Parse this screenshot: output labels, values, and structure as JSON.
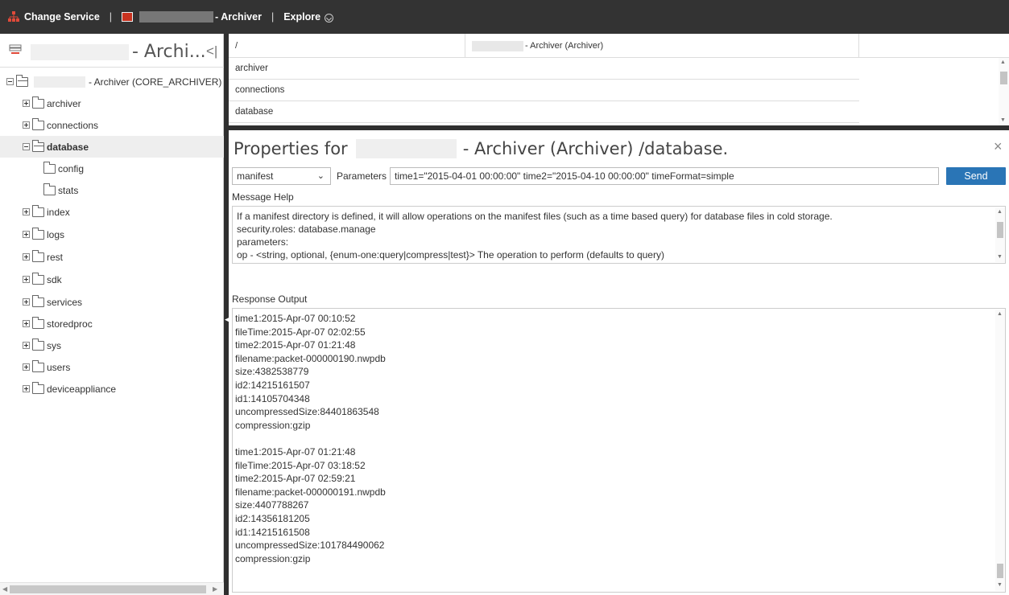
{
  "topbar": {
    "change_service": "Change Service",
    "service_name_suffix": "- Archiver",
    "explore": "Explore"
  },
  "left": {
    "title": "- Archi...",
    "collapse_symbol": "<|",
    "root_label": "- Archiver (CORE_ARCHIVER)",
    "items": [
      {
        "label": "archiver"
      },
      {
        "label": "connections"
      },
      {
        "label": "database"
      },
      {
        "label": "config"
      },
      {
        "label": "stats"
      },
      {
        "label": "index"
      },
      {
        "label": "logs"
      },
      {
        "label": "rest"
      },
      {
        "label": "sdk"
      },
      {
        "label": "services"
      },
      {
        "label": "storedproc"
      },
      {
        "label": "sys"
      },
      {
        "label": "users"
      },
      {
        "label": "deviceappliance"
      }
    ]
  },
  "nodes": {
    "path": "/",
    "path_name": "- Archiver (Archiver)",
    "items": [
      "archiver",
      "connections",
      "database"
    ]
  },
  "props": {
    "title_prefix": "Properties for",
    "title_suffix": "- Archiver (Archiver) /database.",
    "close": "×",
    "message": "manifest",
    "parameters_label": "Parameters",
    "parameters_value": "time1=\"2015-04-01 00:00:00\" time2=\"2015-04-10 00:00:00\" timeFormat=simple",
    "send": "Send",
    "help_label": "Message Help",
    "help_lines": [
      "If a manifest directory is defined, it will allow operations on the manifest files (such as a time based query) for database files in cold storage.",
      "security.roles: database.manage",
      "parameters:",
      "   op - <string, optional, {enum-one:query|compress|test}> The operation to perform (defaults to query)"
    ],
    "response_label": "Response Output",
    "response_lines": [
      "time1:2015-Apr-07 00:10:52",
      " fileTime:2015-Apr-07 02:02:55",
      " time2:2015-Apr-07 01:21:48",
      " filename:packet-000000190.nwpdb",
      " size:4382538779",
      " id2:14215161507",
      " id1:14105704348",
      " uncompressedSize:84401863548",
      " compression:gzip",
      "",
      "time1:2015-Apr-07 01:21:48",
      " fileTime:2015-Apr-07 03:18:52",
      " time2:2015-Apr-07 02:59:21",
      " filename:packet-000000191.nwpdb",
      " size:4407788267",
      " id2:14356181205",
      " id1:14215161508",
      " uncompressedSize:101784490062",
      " compression:gzip"
    ]
  },
  "colors": {
    "topbar_bg": "#333333",
    "accent_red": "#e04a3a",
    "send_blue": "#2a75b6",
    "selected_row": "#eeeeee"
  }
}
